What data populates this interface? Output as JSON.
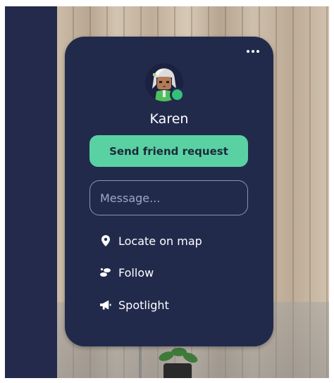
{
  "profile": {
    "name": "Karen",
    "status": "online"
  },
  "actions": {
    "send_friend_request": "Send friend request",
    "message_placeholder": "Message...",
    "locate_on_map": "Locate on map",
    "follow": "Follow",
    "spotlight": "Spotlight"
  },
  "menu": {
    "more_icon": "more-horizontal-icon"
  },
  "colors": {
    "card_bg": "#222a4c",
    "accent": "#5ad1a3",
    "status_online": "#35c07a"
  }
}
